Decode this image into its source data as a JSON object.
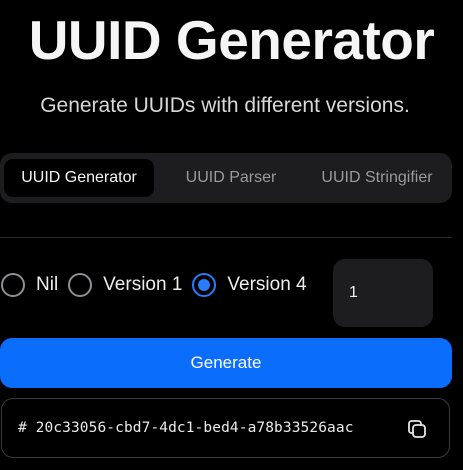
{
  "header": {
    "title": "UUID Generator",
    "subtitle": "Generate UUIDs with different versions."
  },
  "tabs": [
    {
      "label": "UUID Generator",
      "active": true
    },
    {
      "label": "UUID Parser",
      "active": false
    },
    {
      "label": "UUID Stringifier",
      "active": false
    }
  ],
  "versions": {
    "options": [
      {
        "label": "Nil",
        "checked": false
      },
      {
        "label": "Version 1",
        "checked": false
      },
      {
        "label": "Version 4",
        "checked": true
      }
    ]
  },
  "count": {
    "value": "1"
  },
  "generate": {
    "label": "Generate"
  },
  "result": {
    "text": "# 20c33056-cbd7-4dc1-bed4-a78b33526aac",
    "copy_icon": "copy-icon"
  },
  "colors": {
    "accent": "#0a6dfb",
    "background": "#000000",
    "surface": "#1d1d1f"
  }
}
